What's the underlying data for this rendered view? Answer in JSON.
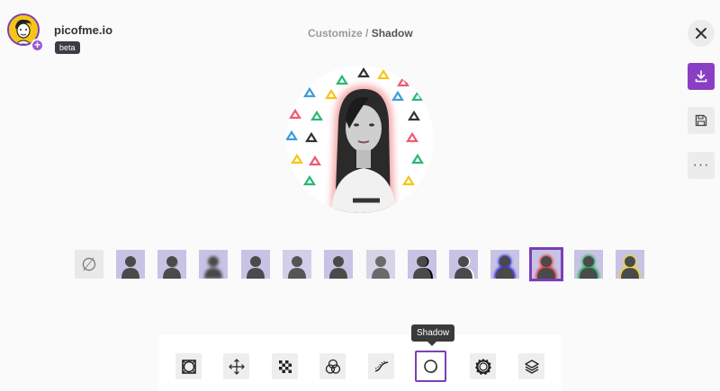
{
  "app": {
    "brand": "picofme.io",
    "badge": "beta"
  },
  "breadcrumb": {
    "parent": "Customize",
    "separator": "/",
    "current": "Shadow"
  },
  "right_toolbar": {
    "items": [
      {
        "name": "close",
        "icon": "close-icon"
      },
      {
        "name": "download",
        "icon": "download-icon"
      },
      {
        "name": "save",
        "icon": "save-icon"
      },
      {
        "name": "more",
        "icon": "more-icon",
        "label": "···"
      }
    ]
  },
  "shadow_variants": {
    "none_icon": "∅",
    "items": [
      {
        "id": "none",
        "style": "none"
      },
      {
        "id": "v1",
        "style": "flat"
      },
      {
        "id": "v2",
        "style": "drop"
      },
      {
        "id": "v3",
        "style": "blur"
      },
      {
        "id": "v4",
        "style": "flat"
      },
      {
        "id": "v5",
        "style": "soft"
      },
      {
        "id": "v6",
        "style": "flat"
      },
      {
        "id": "v7",
        "style": "gray"
      },
      {
        "id": "v8",
        "style": "black-edge"
      },
      {
        "id": "v9",
        "style": "white-edge"
      },
      {
        "id": "v10",
        "style": "blue-glow"
      },
      {
        "id": "v11",
        "style": "red-glow",
        "selected": true
      },
      {
        "id": "v12",
        "style": "green-glow"
      },
      {
        "id": "v13",
        "style": "yellow-glow"
      }
    ]
  },
  "bottom_toolbar": {
    "tooltip": "Shadow",
    "tools": [
      {
        "name": "frame",
        "icon": "frame-icon"
      },
      {
        "name": "move",
        "icon": "move-icon"
      },
      {
        "name": "transparency",
        "icon": "checker-icon"
      },
      {
        "name": "color-blend",
        "icon": "color-circles-icon"
      },
      {
        "name": "curve",
        "icon": "curve-icon"
      },
      {
        "name": "shadow",
        "icon": "shadow-icon",
        "active": true
      },
      {
        "name": "border",
        "icon": "gear-border-icon"
      },
      {
        "name": "layers",
        "icon": "layers-icon"
      }
    ]
  },
  "colors": {
    "accent": "#8a3ec4",
    "selected_border": "#7b3fb6"
  }
}
